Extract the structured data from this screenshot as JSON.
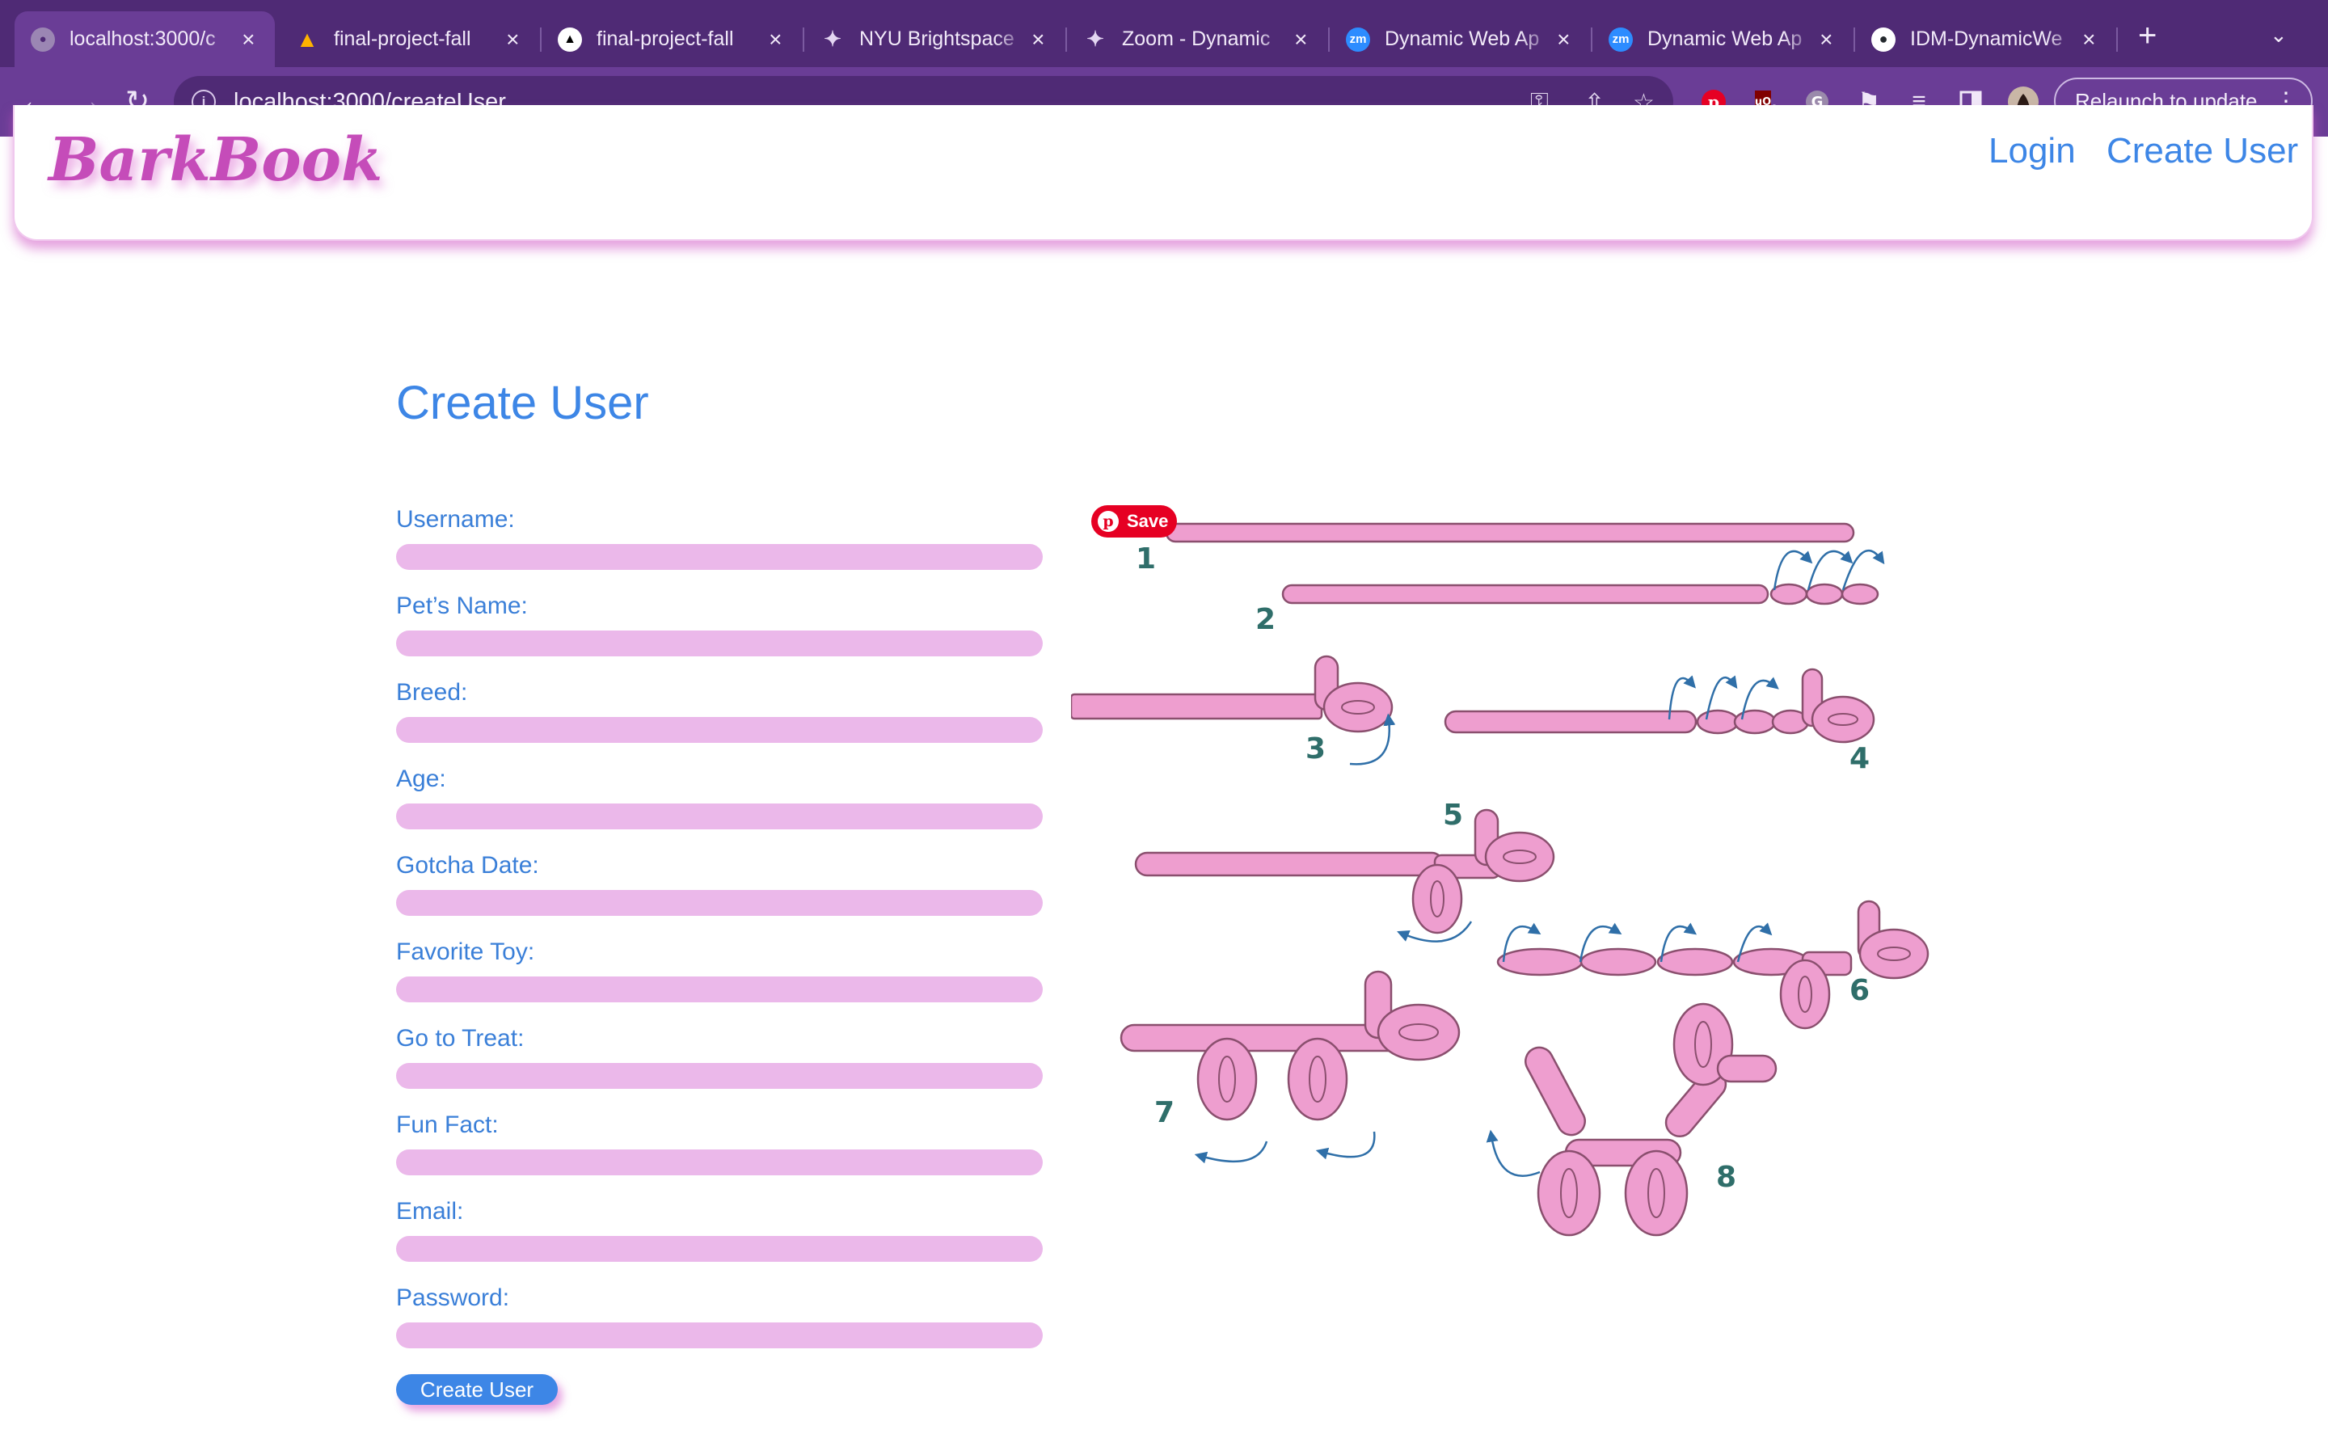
{
  "browser": {
    "tabs": [
      {
        "title": "localhost:3000/c",
        "favicon": "globe-icon"
      },
      {
        "title": "final-project-fall",
        "favicon": "firebase-icon"
      },
      {
        "title": "final-project-fall",
        "favicon": "vercel-icon"
      },
      {
        "title": "NYU Brightspace",
        "favicon": "nyu-torch-icon"
      },
      {
        "title": "Zoom - Dynamic",
        "favicon": "nyu-torch-icon"
      },
      {
        "title": "Dynamic Web Ap",
        "favicon": "zoom-icon"
      },
      {
        "title": "Dynamic Web Ap",
        "favicon": "zoom-icon"
      },
      {
        "title": "IDM-DynamicWe",
        "favicon": "github-icon"
      }
    ],
    "zoom_favicon_text": "zm",
    "url": "localhost:3000/createUser",
    "relaunch_label": "Relaunch to update",
    "ublock_badge": "2",
    "accent_colors": {
      "tabstrip": "#4f2a75",
      "toolbar": "#6a3d96"
    }
  },
  "site": {
    "logo": "BarkBook",
    "nav": {
      "login": "Login",
      "create_user": "Create User"
    }
  },
  "form": {
    "title": "Create User",
    "fields": [
      {
        "label": "Username:"
      },
      {
        "label": "Pet’s Name:"
      },
      {
        "label": "Breed:"
      },
      {
        "label": "Age:"
      },
      {
        "label": "Gotcha Date:"
      },
      {
        "label": "Favorite Toy:"
      },
      {
        "label": "Go to Treat:"
      },
      {
        "label": "Fun Fact:"
      },
      {
        "label": "Email:"
      },
      {
        "label": "Password:"
      }
    ],
    "submit_label": "Create User"
  },
  "illustration": {
    "save_label": "Save",
    "steps": [
      "1",
      "2",
      "3",
      "4",
      "5",
      "6",
      "7",
      "8"
    ]
  },
  "colors": {
    "link": "#3d86e6",
    "logo": "#c54cb9",
    "input_bg": "#ebb8ea",
    "balloon": "#ee9ecf"
  }
}
